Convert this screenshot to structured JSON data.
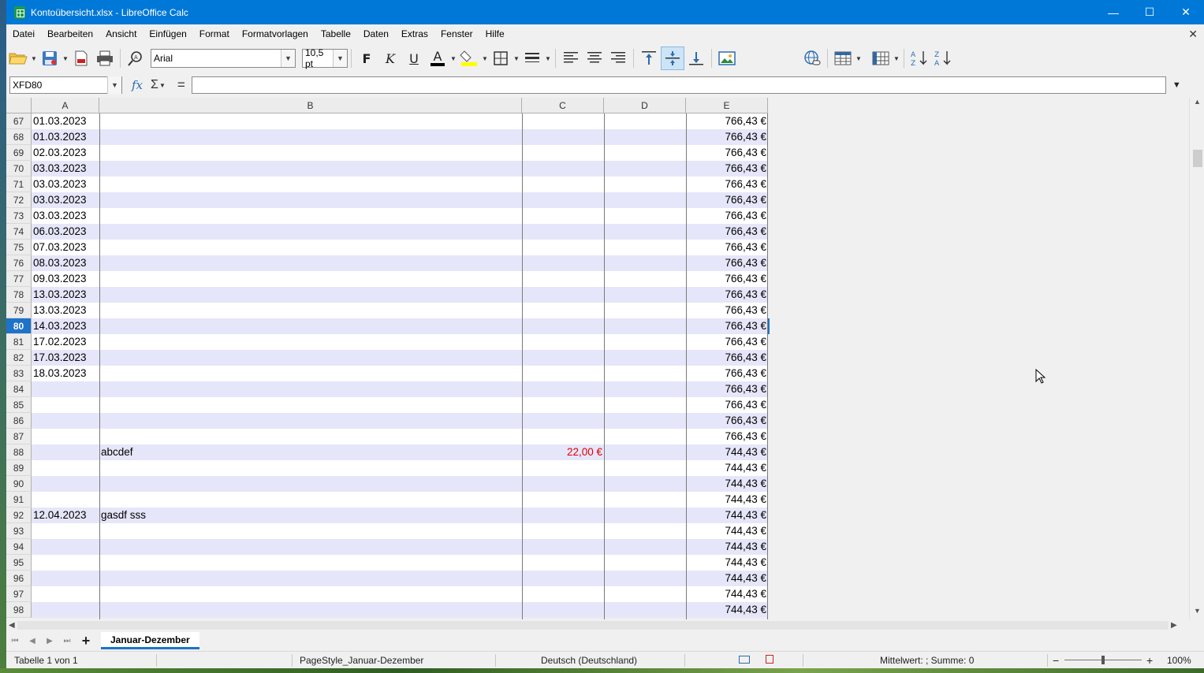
{
  "window": {
    "title": "Kontoübersicht.xlsx - LibreOffice Calc",
    "minimize": "—",
    "maximize": "☐",
    "close": "✕"
  },
  "menu": [
    "Datei",
    "Bearbeiten",
    "Ansicht",
    "Einfügen",
    "Format",
    "Formatvorlagen",
    "Tabelle",
    "Daten",
    "Extras",
    "Fenster",
    "Hilfe"
  ],
  "doc_close": "✕",
  "toolbar": {
    "font_name": "Arial",
    "font_size": "10,5 pt",
    "bold": "F",
    "italic": "K",
    "underline": "U",
    "font_color_letter": "A",
    "colors": {
      "font_color": "#000000",
      "highlight": "#ffff00",
      "accent": "#0078d7"
    }
  },
  "formula_bar": {
    "name_box": "XFD80",
    "fx": "fx",
    "sigma": "Σ",
    "equals": "=",
    "content": ""
  },
  "columns": [
    "A",
    "B",
    "C",
    "D",
    "E"
  ],
  "selected_row": "80",
  "rows": [
    {
      "n": "67",
      "a": "01.03.2023",
      "b": "",
      "c": "",
      "e": "766,43 €"
    },
    {
      "n": "68",
      "a": "01.03.2023",
      "b": "",
      "c": "",
      "e": "766,43 €"
    },
    {
      "n": "69",
      "a": "02.03.2023",
      "b": "",
      "c": "",
      "e": "766,43 €"
    },
    {
      "n": "70",
      "a": "03.03.2023",
      "b": "",
      "c": "",
      "e": "766,43 €"
    },
    {
      "n": "71",
      "a": "03.03.2023",
      "b": "",
      "c": "",
      "e": "766,43 €"
    },
    {
      "n": "72",
      "a": "03.03.2023",
      "b": "",
      "c": "",
      "e": "766,43 €"
    },
    {
      "n": "73",
      "a": "03.03.2023",
      "b": "",
      "c": "",
      "e": "766,43 €"
    },
    {
      "n": "74",
      "a": "06.03.2023",
      "b": "",
      "c": "",
      "e": "766,43 €"
    },
    {
      "n": "75",
      "a": "07.03.2023",
      "b": "",
      "c": "",
      "e": "766,43 €"
    },
    {
      "n": "76",
      "a": "08.03.2023",
      "b": "",
      "c": "",
      "e": "766,43 €"
    },
    {
      "n": "77",
      "a": "09.03.2023",
      "b": "",
      "c": "",
      "e": "766,43 €"
    },
    {
      "n": "78",
      "a": "13.03.2023",
      "b": "",
      "c": "",
      "e": "766,43 €"
    },
    {
      "n": "79",
      "a": "13.03.2023",
      "b": "",
      "c": "",
      "e": "766,43 €"
    },
    {
      "n": "80",
      "a": "14.03.2023",
      "b": "",
      "c": "",
      "e": "766,43 €"
    },
    {
      "n": "81",
      "a": "17.02.2023",
      "b": "",
      "c": "",
      "e": "766,43 €"
    },
    {
      "n": "82",
      "a": "17.03.2023",
      "b": "",
      "c": "",
      "e": "766,43 €"
    },
    {
      "n": "83",
      "a": "18.03.2023",
      "b": "",
      "c": "",
      "e": "766,43 €"
    },
    {
      "n": "84",
      "a": "",
      "b": "",
      "c": "",
      "e": "766,43 €"
    },
    {
      "n": "85",
      "a": "",
      "b": "",
      "c": "",
      "e": "766,43 €"
    },
    {
      "n": "86",
      "a": "",
      "b": "",
      "c": "",
      "e": "766,43 €"
    },
    {
      "n": "87",
      "a": "",
      "b": "",
      "c": "",
      "e": "766,43 €"
    },
    {
      "n": "88",
      "a": "",
      "b": "abcdef",
      "c": "22,00 €",
      "e": "744,43 €"
    },
    {
      "n": "89",
      "a": "",
      "b": "",
      "c": "",
      "e": "744,43 €"
    },
    {
      "n": "90",
      "a": "",
      "b": "",
      "c": "",
      "e": "744,43 €"
    },
    {
      "n": "91",
      "a": "",
      "b": "",
      "c": "",
      "e": "744,43 €"
    },
    {
      "n": "92",
      "a": "12.04.2023",
      "b": "gasdf sss",
      "c": "",
      "e": "744,43 €"
    },
    {
      "n": "93",
      "a": "",
      "b": "",
      "c": "",
      "e": "744,43 €"
    },
    {
      "n": "94",
      "a": "",
      "b": "",
      "c": "",
      "e": "744,43 €"
    },
    {
      "n": "95",
      "a": "",
      "b": "",
      "c": "",
      "e": "744,43 €"
    },
    {
      "n": "96",
      "a": "",
      "b": "",
      "c": "",
      "e": "744,43 €"
    },
    {
      "n": "97",
      "a": "",
      "b": "",
      "c": "",
      "e": "744,43 €"
    },
    {
      "n": "98",
      "a": "",
      "b": "",
      "c": "",
      "e": "744,43 €"
    }
  ],
  "sheet_tabs": {
    "add": "+",
    "active": "Januar-Dezember"
  },
  "status": {
    "sheet": "Tabelle 1 von 1",
    "page_style": "PageStyle_Januar-Dezember",
    "language": "Deutsch (Deutschland)",
    "selection_summary": "Mittelwert: ; Summe: 0",
    "zoom": "100%",
    "zoom_minus": "−",
    "zoom_plus": "+"
  }
}
